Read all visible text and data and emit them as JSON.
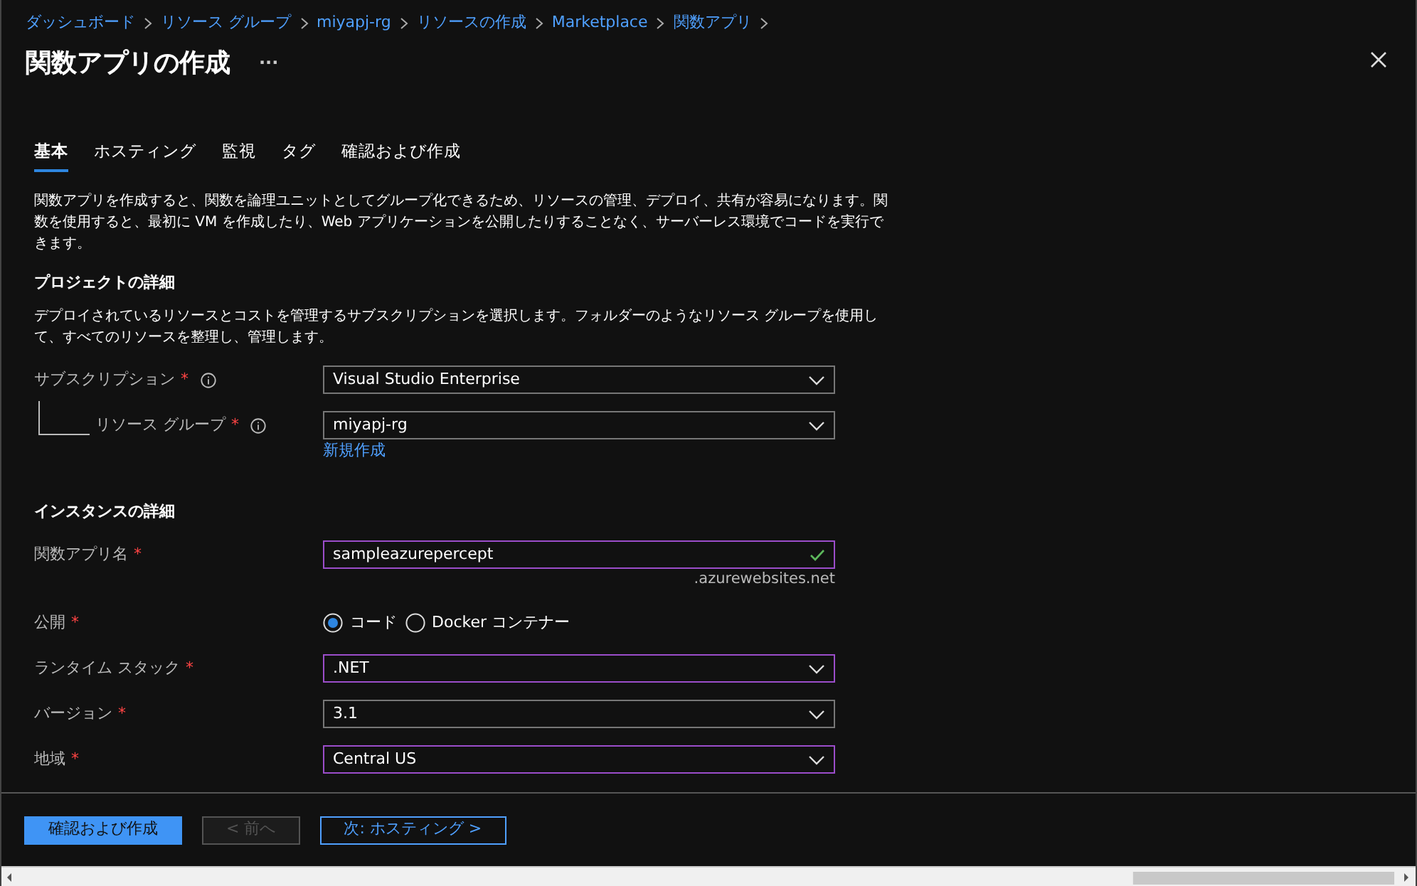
{
  "breadcrumb": [
    "ダッシュボード",
    "リソース グループ",
    "miyapj-rg",
    "リソースの作成",
    "Marketplace",
    "関数アプリ"
  ],
  "title": "関数アプリの作成",
  "more": "···",
  "tabs": [
    {
      "label": "基本",
      "selected": true
    },
    {
      "label": "ホスティング",
      "selected": false
    },
    {
      "label": "監視",
      "selected": false
    },
    {
      "label": "タグ",
      "selected": false
    },
    {
      "label": "確認および作成",
      "selected": false
    }
  ],
  "description": "関数アプリを作成すると、関数を論理ユニットとしてグループ化できるため、リソースの管理、デプロイ、共有が容易になります。関数を使用すると、最初に VM を作成したり、Web アプリケーションを公開したりすることなく、サーバーレス環境でコードを実行できます。",
  "sections": [
    {
      "heading": "プロジェクトの詳細",
      "description": "デプロイされているリソースとコストを管理するサブスクリプションを選択します。フォルダーのようなリソース グループを使用して、すべてのリソースを整理し、管理します。",
      "fields": [
        {
          "kind": "select",
          "label": "サブスクリプション",
          "required_mark": "*",
          "info": true,
          "value": "Visual Studio Enterprise",
          "highlighted": false,
          "children": [
            {
              "kind": "select",
              "label": "リソース グループ",
              "required_mark": "*",
              "info": true,
              "value": "miyapj-rg",
              "highlighted": false,
              "link": "新規作成"
            }
          ]
        }
      ]
    },
    {
      "heading": "インスタンスの詳細",
      "fields": [
        {
          "kind": "text",
          "label": "関数アプリ名",
          "required_mark": "*",
          "value": "sampleazurepercept",
          "highlighted": true,
          "valid": true,
          "suffix": ".azurewebsites.net"
        },
        {
          "kind": "radio",
          "label": "公開",
          "required_mark": "*",
          "options": [
            {
              "label": "コード",
              "selected": true
            },
            {
              "label": "Docker コンテナー",
              "selected": false
            }
          ]
        },
        {
          "kind": "select",
          "label": "ランタイム スタック",
          "required_mark": "*",
          "value": ".NET",
          "highlighted": true
        },
        {
          "kind": "select",
          "label": "バージョン",
          "required_mark": "*",
          "value": "3.1",
          "highlighted": false
        },
        {
          "kind": "select",
          "label": "地域",
          "required_mark": "*",
          "value": "Central US",
          "highlighted": true
        }
      ]
    }
  ],
  "buttons": [
    {
      "kind": "primary",
      "label": "確認および作成"
    },
    {
      "kind": "disabled",
      "label": "< 前へ"
    },
    {
      "kind": "outline",
      "label": "次: ホスティング >"
    }
  ]
}
